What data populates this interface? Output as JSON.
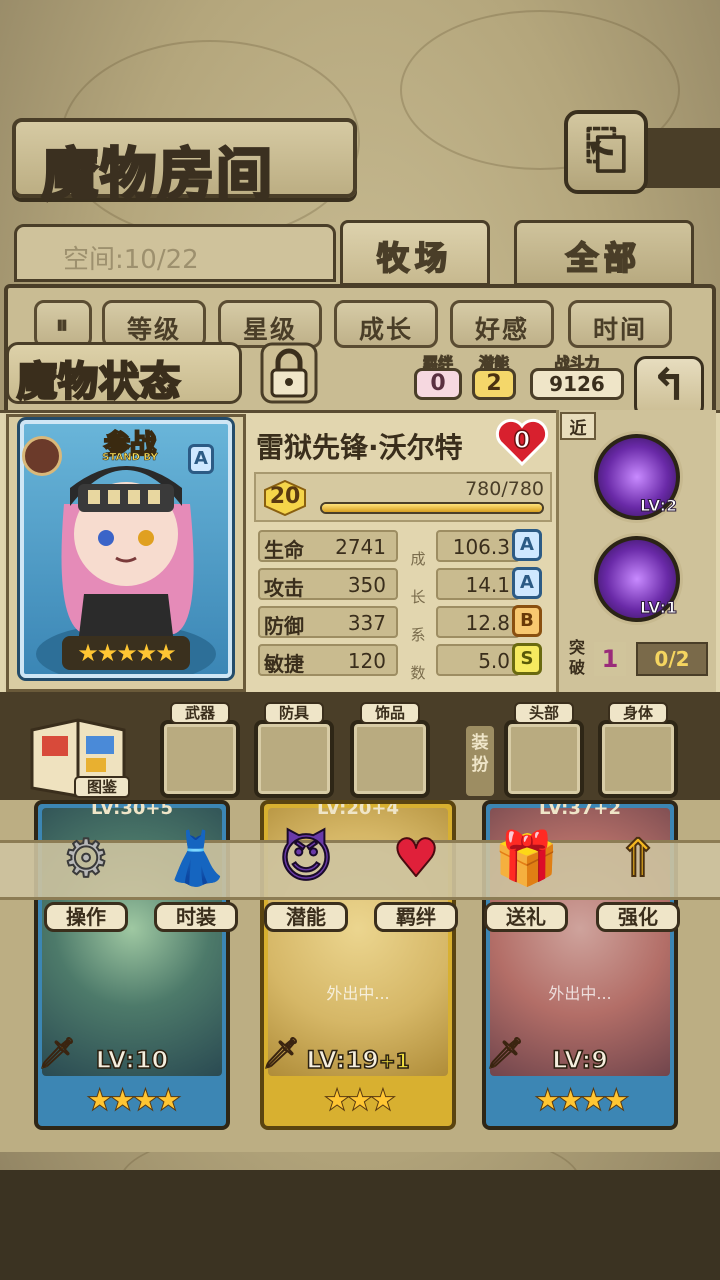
{
  "header": {
    "title": "魔物房间",
    "back_icon": "back-arrow-icon"
  },
  "tabs": {
    "space_label": "空间:10/22",
    "items": [
      {
        "label": "牧场",
        "active": true
      },
      {
        "label": "全部",
        "active": false
      }
    ]
  },
  "sort": {
    "toggle_icon": "pause-sort-icon",
    "items": [
      {
        "label": "等级"
      },
      {
        "label": "星级"
      },
      {
        "label": "成长"
      },
      {
        "label": "好感"
      },
      {
        "label": "时间"
      }
    ]
  },
  "status": {
    "title": "魔物状态",
    "lock_icon": "padlock-icon",
    "bond_label": "羁绊",
    "bond_value": "0",
    "potential_label": "潜能",
    "potential_value": "2",
    "power_label": "战斗力",
    "power_value": "9126",
    "return_icon": "return-arrow-icon"
  },
  "monster": {
    "standby_main": "参战",
    "standby_sub": "STAND BY",
    "rank": "A",
    "stars": "★★★★★",
    "name": "雷狱先锋·沃尔特",
    "heart_value": "0",
    "level": "20",
    "exp_text": "780/780",
    "exp_fraction": 1.0,
    "growth_label": "成长系数",
    "stats": [
      {
        "name": "生命",
        "value": "2741",
        "growth": "106.3",
        "grade": "A"
      },
      {
        "name": "攻击",
        "value": "350",
        "growth": "14.1",
        "grade": "A"
      },
      {
        "name": "防御",
        "value": "337",
        "growth": "12.8",
        "grade": "B"
      },
      {
        "name": "敏捷",
        "value": "120",
        "growth": "5.0",
        "grade": "S"
      }
    ]
  },
  "skills": {
    "range_tag": "近",
    "items": [
      {
        "level": "LV:2"
      },
      {
        "level": "LV:1"
      }
    ],
    "break_label": "突破",
    "break_value": "1",
    "break_progress": "0/2"
  },
  "equipment": {
    "book_label": "图鉴",
    "dress_label": "装扮",
    "slots": [
      {
        "label": "武器"
      },
      {
        "label": "防具"
      },
      {
        "label": "饰品"
      },
      {
        "label": "头部"
      },
      {
        "label": "身体"
      }
    ]
  },
  "actions": [
    {
      "label": "操作",
      "icon": "gear-icon"
    },
    {
      "label": "时装",
      "icon": "outfit-icon"
    },
    {
      "label": "潜能",
      "icon": "demon-icon"
    },
    {
      "label": "羁绊",
      "icon": "hearts-icon"
    },
    {
      "label": "送礼",
      "icon": "gift-icon"
    },
    {
      "label": "强化",
      "icon": "upgrade-arrows-icon"
    }
  ],
  "cards": [
    {
      "top_level": "LV:30+5",
      "status": "",
      "level": "LV:10",
      "level_bonus": "",
      "stars": "★★★★"
    },
    {
      "top_level": "LV:20+4",
      "status": "外出中...",
      "level": "LV:19",
      "level_bonus": "+1",
      "stars": "★★★"
    },
    {
      "top_level": "LV:37+2",
      "status": "外出中...",
      "level": "LV:9",
      "level_bonus": "",
      "stars": "★★★★"
    }
  ]
}
